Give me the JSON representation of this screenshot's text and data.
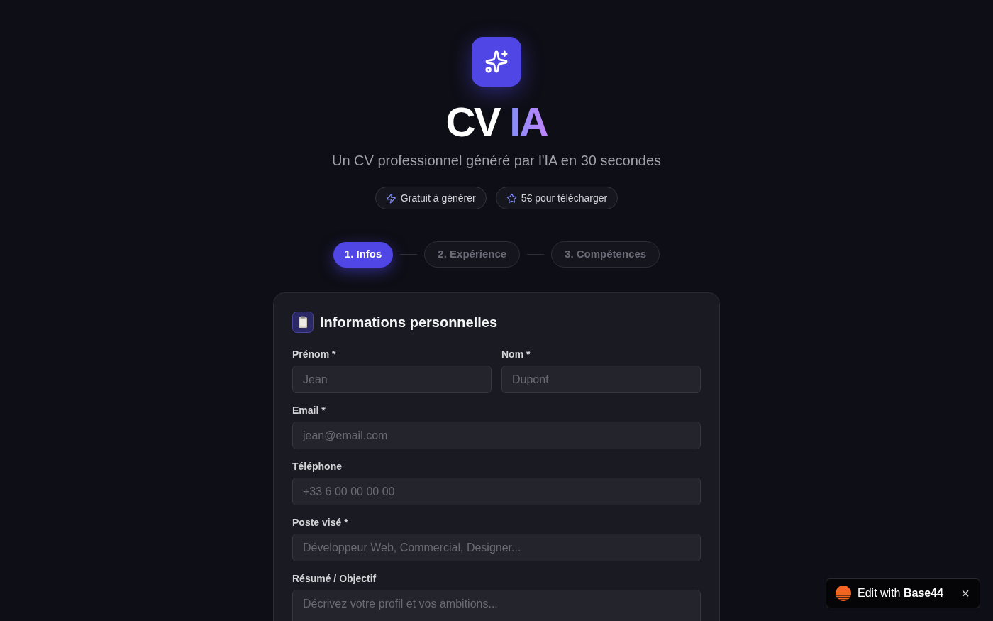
{
  "header": {
    "title": {
      "main": "CV",
      "accent": "IA"
    },
    "subtitle": "Un CV professionnel généré par l'IA en 30 secondes",
    "badges": [
      {
        "label": "Gratuit à générer"
      },
      {
        "label": "5€ pour télécharger"
      }
    ]
  },
  "steps": [
    {
      "label": "1. Infos",
      "selected": true
    },
    {
      "label": "2. Expérience",
      "selected": false
    },
    {
      "label": "3. Compétences",
      "selected": false
    }
  ],
  "form": {
    "title": "Informations personnelles",
    "rows": [
      [
        {
          "label": "Prénom *",
          "placeholder": "Jean",
          "kind": "input"
        },
        {
          "label": "Nom *",
          "placeholder": "Dupont",
          "kind": "input"
        }
      ],
      [
        {
          "label": "Email *",
          "placeholder": "jean@email.com",
          "kind": "input"
        }
      ],
      [
        {
          "label": "Téléphone",
          "placeholder": "+33 6 00 00 00 00",
          "kind": "input"
        }
      ],
      [
        {
          "label": "Poste visé *",
          "placeholder": "Développeur Web, Commercial, Designer...",
          "kind": "input"
        }
      ],
      [
        {
          "label": "Résumé / Objectif",
          "placeholder": "Décrivez votre profil et vos ambitions...",
          "kind": "textarea"
        }
      ]
    ]
  },
  "edit_badge": {
    "label": "Edit with **Base44**",
    "close": "×"
  }
}
